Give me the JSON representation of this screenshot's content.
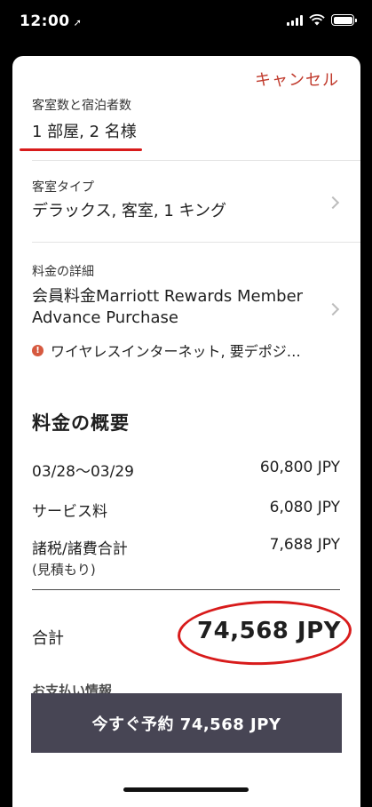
{
  "status_bar": {
    "time": "12:00",
    "location_arrow": "➚"
  },
  "header": {
    "cancel_label": "キャンセル"
  },
  "rooms_guests": {
    "label": "客室数と宿泊者数",
    "value": "1 部屋, 2 名様"
  },
  "room_type": {
    "label": "客室タイプ",
    "value": "デラックス, 客室, 1 キング"
  },
  "rate_details": {
    "label": "料金の詳細",
    "value_line1": "会員料金Marriott Rewards Member",
    "value_line2": "Advance Purchase",
    "warning": "ワイヤレスインターネット, 要デポジ…"
  },
  "summary": {
    "title": "料金の概要",
    "rows": [
      {
        "label": "03/28〜03/29",
        "value": "60,800 JPY"
      },
      {
        "label": "サービス料",
        "value": "6,080 JPY"
      },
      {
        "label": "諸税/諸費合計",
        "note": "(見積もり)",
        "value": "7,688 JPY"
      }
    ],
    "total_label": "合計",
    "total_value": "74,568 JPY"
  },
  "payment_peek": "お支払い情報",
  "book_button": {
    "label": "今すぐ予約 74,568 JPY"
  },
  "colors": {
    "accent_red": "#c0392b",
    "button_bg": "#474554",
    "annotation_red": "#d81b1b"
  }
}
